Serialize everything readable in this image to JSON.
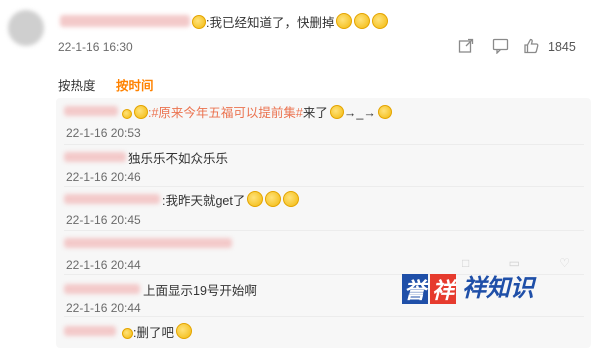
{
  "comment": {
    "text": ":我已经知道了，快删掉",
    "time": "22-1-16 16:30",
    "like_count": "1845"
  },
  "sort": {
    "by_hot": "按热度",
    "by_time": "按时间"
  },
  "replies": [
    {
      "text": ":#原来今年五福可以提前集#",
      "suffix": "来了",
      "arrows": "→_→",
      "time": "22-1-16 20:53"
    },
    {
      "text": "独乐乐不如众乐乐",
      "time": "22-1-16 20:46"
    },
    {
      "text": ":我昨天就get了",
      "time": "22-1-16 20:45"
    },
    {
      "text": "",
      "time": "22-1-16 20:44"
    },
    {
      "text": "上面显示19号开始啊",
      "time": ""
    },
    {
      "text": ":删了吧",
      "time": ""
    }
  ],
  "reply_last_time": "22-1-16 20:44",
  "watermark": {
    "text": "誉祥祥知识"
  }
}
